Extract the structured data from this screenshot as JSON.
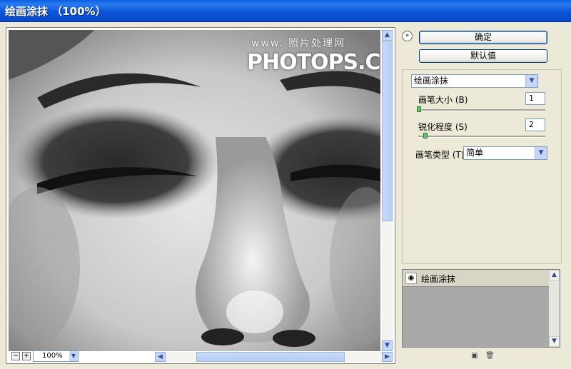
{
  "window": {
    "title": "绘画涂抹 （100%）"
  },
  "watermark": {
    "line1": "www.  照片处理网",
    "line2": "PHOTOPS.COM"
  },
  "preview": {
    "zoom": "100%",
    "zoom_out": "−",
    "zoom_in": "+"
  },
  "buttons": {
    "ok": "确定",
    "default": "默认值",
    "collapse": "»"
  },
  "filter": {
    "selected": "绘画涂抹"
  },
  "params": {
    "brush_size": {
      "label": "画笔大小 (B)",
      "value": "1",
      "fraction": 0.0
    },
    "sharpness": {
      "label": "锐化程度 (S)",
      "value": "2",
      "fraction": 0.05
    },
    "brush_type": {
      "label": "画笔类型 (T)：",
      "value": "简单"
    }
  },
  "layers": {
    "name": "绘画涂抹"
  },
  "colors": {
    "titlebar": "#0a5fe0",
    "panel": "#ece9d8"
  }
}
